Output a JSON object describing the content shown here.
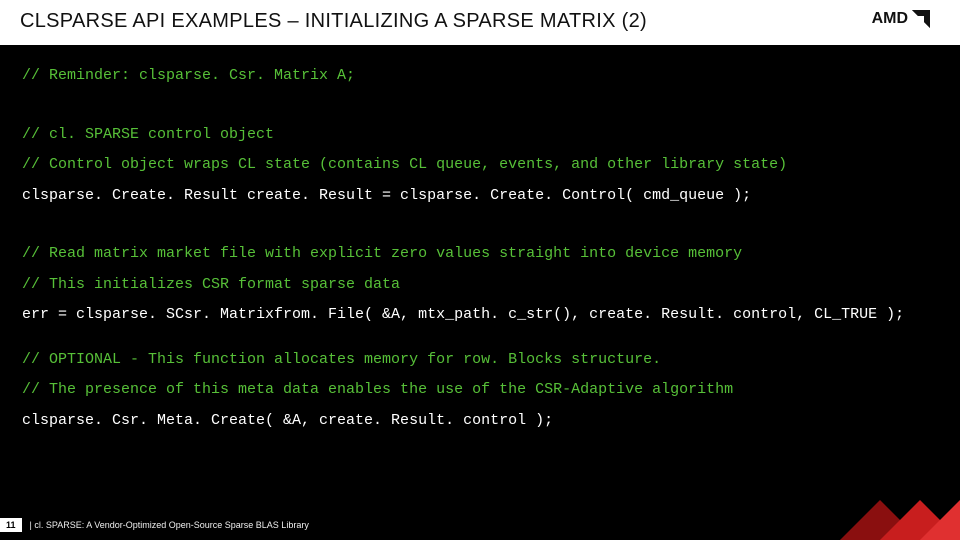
{
  "header": {
    "title": "CLSPARSE API EXAMPLES – INITIALIZING A SPARSE MATRIX (2)",
    "brand": "AMD"
  },
  "code": {
    "l1": "// Reminder: clsparse. Csr. Matrix A;",
    "l2": "// cl. SPARSE control object",
    "l3": "// Control object wraps CL state (contains CL queue, events, and other library state)",
    "l4": "clsparse. Create. Result create. Result = clsparse. Create. Control( cmd_queue );",
    "l5": "// Read matrix market file with explicit zero values straight into device memory",
    "l6": "// This initializes CSR format sparse data",
    "l7": "err = clsparse. SCsr. Matrixfrom. File( &A, mtx_path. c_str(), create. Result. control, CL_TRUE );",
    "l8": "// OPTIONAL - This function allocates memory for row. Blocks structure.",
    "l9": "// The presence of this meta data enables the use of the CSR-Adaptive algorithm",
    "l10": "clsparse. Csr. Meta. Create( &A, create. Result. control );"
  },
  "footer": {
    "page": "11",
    "text": "|  cl. SPARSE: A Vendor-Optimized Open-Source Sparse BLAS Library"
  }
}
